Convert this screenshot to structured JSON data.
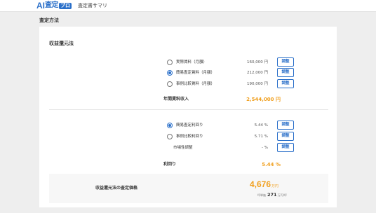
{
  "header": {
    "logo_ai": "AI",
    "logo_kanji": "査定",
    "logo_pro": "プロ",
    "subtitle": "査定書サマリ"
  },
  "section_heading": "査定方法",
  "card": {
    "title": "収益還元法",
    "rent_rows": [
      {
        "label": "実際賃料（月額）",
        "value": "160,000 円",
        "selected": false,
        "button": "調整"
      },
      {
        "label": "簡易査定賃料（月額）",
        "value": "212,000 円",
        "selected": true,
        "button": "調整"
      },
      {
        "label": "事例比較賃料（月額）",
        "value": "190,000 円",
        "selected": false,
        "button": "調整"
      }
    ],
    "annual_income": {
      "label": "年間賃料収入",
      "value": "2,544,000 円"
    },
    "yield_rows": [
      {
        "label": "簡易査定利回り",
        "value": "5.44 %",
        "selected": true,
        "button": "調整"
      },
      {
        "label": "事例比較利回り",
        "value": "5.71 %",
        "selected": false,
        "button": "調整"
      },
      {
        "label": "市場性調整",
        "value": "- %",
        "button": "調整"
      }
    ],
    "yield_total": {
      "label": "利回り",
      "value": "5.44 %"
    },
    "price": {
      "label": "収益還元法の査定価格",
      "main_number": "4,676",
      "main_unit": "万円",
      "sub_prefix": "坪単価",
      "sub_number": "271",
      "sub_unit": "万円/坪"
    }
  },
  "colors": {
    "accent": "#2a6fc9",
    "highlight": "#f0a020",
    "background": "#eeeeee"
  }
}
